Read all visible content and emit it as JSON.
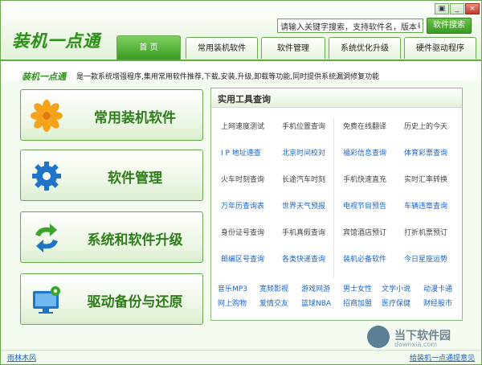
{
  "app": {
    "title": "装机一点通"
  },
  "window_buttons": {
    "skin": "▣",
    "minimize": "_",
    "close": "×"
  },
  "search": {
    "value": "请输入关键字搜索，支持软件名，版本号",
    "button": "软件搜索"
  },
  "tabs": [
    {
      "label": "首 页",
      "active": true
    },
    {
      "label": "常用装机软件",
      "active": false
    },
    {
      "label": "软件管理",
      "active": false
    },
    {
      "label": "系统优化升级",
      "active": false
    },
    {
      "label": "硬件驱动程序",
      "active": false
    }
  ],
  "description": {
    "brand": "装机一点通",
    "text": "是一款系统增强程序,集用常用软件推荐,下载,安装,升级,卸载等功能,同时提供系统漏洞修复功能"
  },
  "big_buttons": [
    {
      "label": "常用装机软件",
      "icon": "flower-icon"
    },
    {
      "label": "软件管理",
      "icon": "gear-icon"
    },
    {
      "label": "系统和软件升级",
      "icon": "refresh-arrows-icon"
    },
    {
      "label": "驱动备份与还原",
      "icon": "monitor-gear-icon"
    }
  ],
  "tools": {
    "title": "实用工具查询",
    "rows": [
      [
        {
          "t": "上网速度测试",
          "c": "gray"
        },
        {
          "t": "手机位置查询",
          "c": "gray"
        },
        {
          "t": "免费在线翻译",
          "c": "gray"
        },
        {
          "t": "历史上的今天",
          "c": "gray"
        }
      ],
      [
        {
          "t": "I P 地址速查",
          "c": "blue"
        },
        {
          "t": "北京时间校对",
          "c": "blue"
        },
        {
          "t": "福彩信息查询",
          "c": "blue"
        },
        {
          "t": "体育彩票查询",
          "c": "blue"
        }
      ],
      [
        {
          "t": "火车时刻查询",
          "c": "gray"
        },
        {
          "t": "长途汽车时刻",
          "c": "gray"
        },
        {
          "t": "手机快速直充",
          "c": "gray"
        },
        {
          "t": "实时汇率转换",
          "c": "gray"
        }
      ],
      [
        {
          "t": "万年历查询表",
          "c": "blue"
        },
        {
          "t": "世界天气预报",
          "c": "blue"
        },
        {
          "t": "电视节目预告",
          "c": "blue"
        },
        {
          "t": "车辆违章查询",
          "c": "blue"
        }
      ],
      [
        {
          "t": "身份证号查询",
          "c": "gray"
        },
        {
          "t": "手机真假查询",
          "c": "gray"
        },
        {
          "t": "宾馆酒店预订",
          "c": "gray"
        },
        {
          "t": "打折机票预订",
          "c": "gray"
        }
      ],
      [
        {
          "t": "邮编区号查询",
          "c": "blue"
        },
        {
          "t": "各类快递查询",
          "c": "blue"
        },
        {
          "t": "装机必备软件",
          "c": "blue"
        },
        {
          "t": "今日星座运势",
          "c": "blue"
        }
      ]
    ],
    "links": [
      [
        "音乐MP3",
        "宽频影视",
        "游戏网游",
        "男士女性",
        "文学小说",
        "动漫卡通"
      ],
      [
        "网上购物",
        "爱情交友",
        "篮球NBA",
        "招商加盟",
        "医疗保健",
        "财经股市"
      ]
    ]
  },
  "status": {
    "left": "雨林木风",
    "right": "给装机一点通提意见"
  },
  "watermark": {
    "title": "当下软件园",
    "sub": "downxia.com"
  }
}
